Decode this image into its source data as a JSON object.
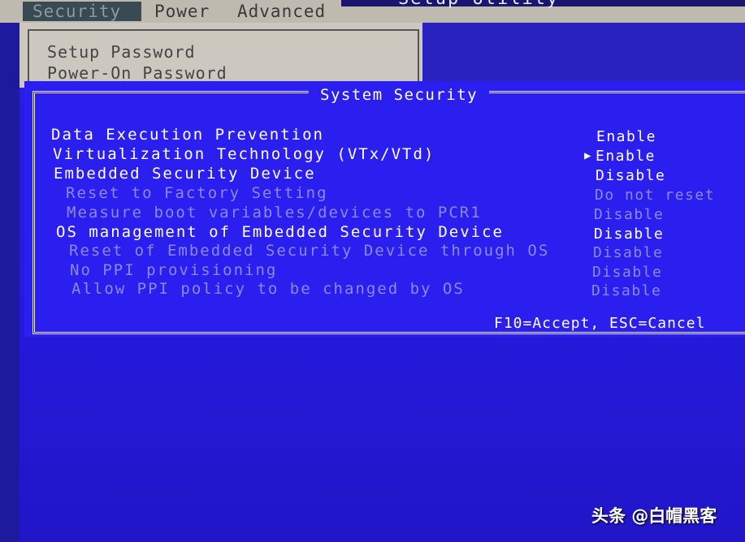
{
  "header": {
    "title": "Setup Utility",
    "menu": [
      "Security",
      "Power",
      "Advanced"
    ],
    "active": "Security"
  },
  "background_panel": {
    "items": [
      "Setup Password",
      "Power-On Password"
    ]
  },
  "dialog": {
    "title": "System Security",
    "footer": "F10=Accept, ESC=Cancel",
    "rows": [
      {
        "label": "Data Execution Prevention",
        "value": "Enable",
        "enabled": true
      },
      {
        "label": "Virtualization Technology (VTx/VTd)",
        "value": "Enable",
        "enabled": true,
        "selected": true
      },
      {
        "label": "Embedded Security Device",
        "value": "Disable",
        "enabled": true
      },
      {
        "label": "Reset to Factory Setting",
        "value": "Do not reset",
        "enabled": false
      },
      {
        "label": "Measure boot variables/devices to PCR1",
        "value": "Disable",
        "enabled": false
      },
      {
        "label": "OS management of Embedded Security Device",
        "value": "Disable",
        "enabled": true
      },
      {
        "label": "Reset of Embedded Security Device through OS",
        "value": "Disable",
        "enabled": false
      },
      {
        "label": "No PPI provisioning",
        "value": "Disable",
        "enabled": false
      },
      {
        "label": "Allow PPI policy to be changed by OS",
        "value": "Disable",
        "enabled": false
      }
    ],
    "selected_marker": "▶"
  },
  "watermark": "头条 @白帽黑客",
  "colors": {
    "background": "#2a1fe6",
    "panel": "#ccc8c0",
    "enabled_text": "#ffffff",
    "disabled_text": "#8d88ee"
  }
}
